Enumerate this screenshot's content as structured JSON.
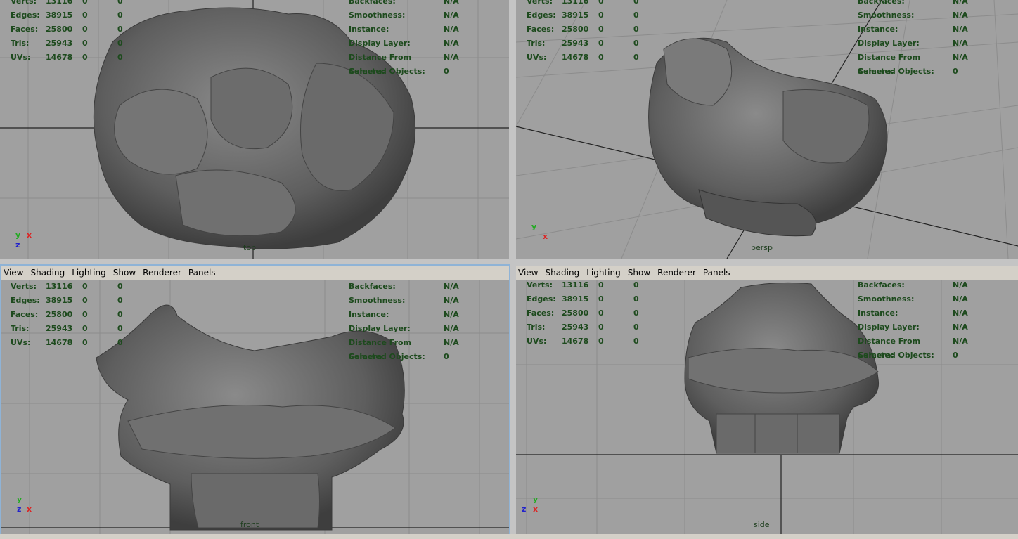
{
  "menu": [
    "View",
    "Shading",
    "Lighting",
    "Show",
    "Renderer",
    "Panels"
  ],
  "stats": {
    "labels": [
      "Verts:",
      "Edges:",
      "Faces:",
      "Tris:",
      "UVs:"
    ],
    "values": [
      [
        "13116",
        "0",
        "0"
      ],
      [
        "38915",
        "0",
        "0"
      ],
      [
        "25800",
        "0",
        "0"
      ],
      [
        "25943",
        "0",
        "0"
      ],
      [
        "14678",
        "0",
        "0"
      ]
    ]
  },
  "info": {
    "labels": [
      "Backfaces:",
      "Smoothness:",
      "Instance:",
      "Display Layer:",
      "Distance From Camera:",
      "Selected Objects:"
    ],
    "values": [
      "N/A",
      "N/A",
      "N/A",
      "N/A",
      "N/A",
      "0"
    ]
  },
  "views": {
    "top": {
      "name": "top",
      "axis": [
        "y",
        "x",
        "z"
      ]
    },
    "persp": {
      "name": "persp",
      "axis": [
        "y",
        "x"
      ]
    },
    "front": {
      "name": "front",
      "axis": [
        "y",
        "z",
        "x"
      ]
    },
    "side": {
      "name": "side",
      "axis": [
        "y",
        "z",
        "x"
      ]
    }
  },
  "colors": {
    "viewport_bg": "#a0a0a0",
    "hud_text": "#1d4a1d",
    "active_border": "#8fb3d6",
    "mesh": "#5e5e5e"
  }
}
